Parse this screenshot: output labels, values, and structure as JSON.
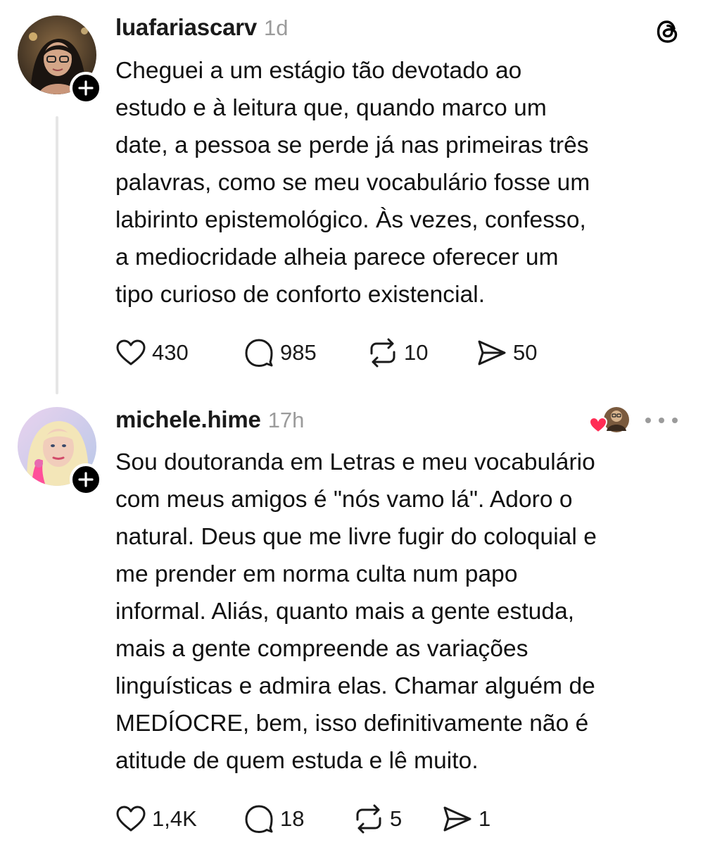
{
  "posts": [
    {
      "username": "luafariascarv",
      "timestamp": "1d",
      "text": "Cheguei a um estágio tão devotado ao\nestudo e à leitura que, quando marco um\ndate, a pessoa se perde já nas primeiras três\npalavras, como se meu vocabulário fosse um\nlabirinto epistemológico. Às vezes, confesso,\na mediocridade alheia parece oferecer um\ntipo curioso de conforto existencial.",
      "likes": "430",
      "replies": "985",
      "reposts": "10",
      "shares": "50"
    },
    {
      "username": "michele.hime",
      "timestamp": "17h",
      "text": "Sou doutoranda em Letras e meu vocabulário\ncom meus amigos é \"nós vamo lá\". Adoro o\nnatural. Deus que me livre fugir do coloquial e\nme prender em norma culta num papo\ninformal.  Aliás, quanto mais a gente estuda,\nmais a gente compreende as variações\nlinguísticas e admira elas. Chamar alguém de\nMEDÍOCRE, bem, isso definitivamente não é\natitude de quem estuda e lê muito.",
      "likes": "1,4K",
      "replies": "18",
      "reposts": "5",
      "shares": "1"
    }
  ],
  "icons": {
    "app_logo": "threads-logo-icon",
    "like": "heart-icon",
    "reply": "comment-bubble-icon",
    "repost": "repost-arrows-icon",
    "share": "send-icon",
    "follow": "plus-icon",
    "more": "more-dots-icon"
  },
  "colors": {
    "text": "#101010",
    "muted": "#9b9b9b",
    "thread_line": "#e6e6e6",
    "liked_heart": "#ff2d55"
  }
}
